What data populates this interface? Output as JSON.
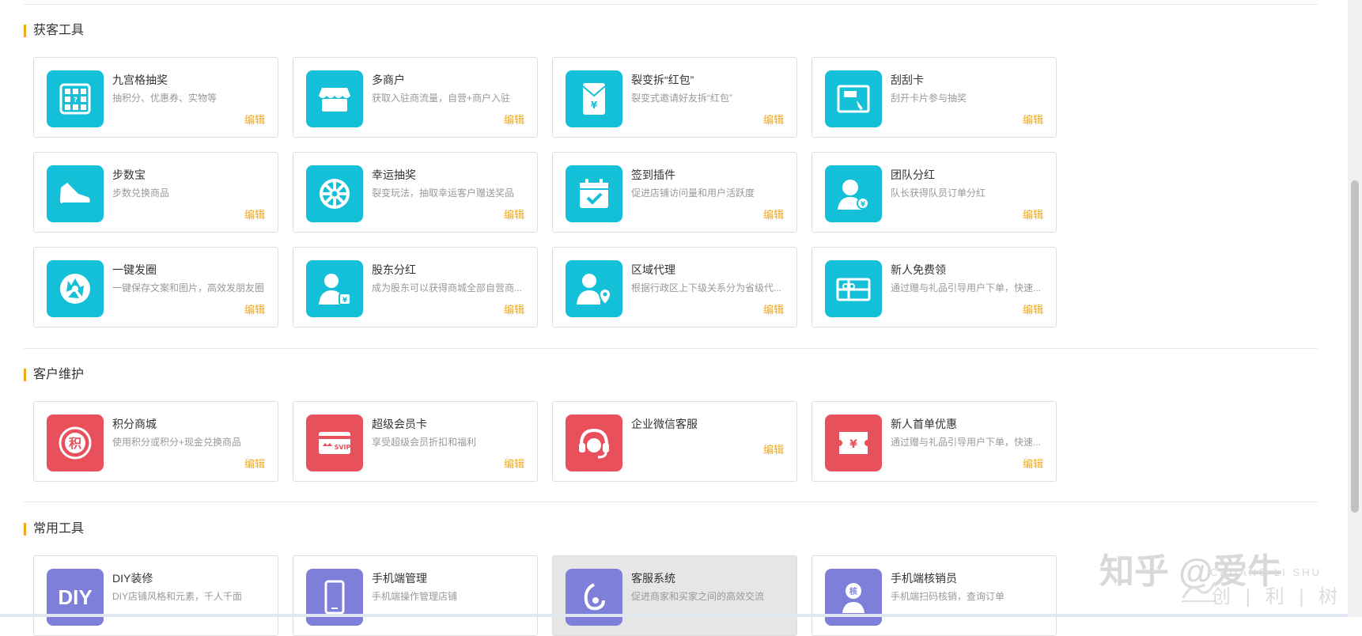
{
  "sections": [
    {
      "title": "获客工具",
      "cards": [
        {
          "title": "九宫格抽奖",
          "desc": "抽积分、优惠券、实物等",
          "edit": "编辑",
          "icon": "grid-lottery-icon",
          "color": "#14c0d8"
        },
        {
          "title": "多商户",
          "desc": "获取入驻商流量，自营+商户入驻",
          "edit": "编辑",
          "icon": "store-icon",
          "color": "#14c0d8"
        },
        {
          "title": "裂变拆“红包”",
          "desc": "裂变式邀请好友拆“红包”",
          "edit": "编辑",
          "icon": "red-envelope-icon",
          "color": "#14c0d8"
        },
        {
          "title": "刮刮卡",
          "desc": "刮开卡片参与抽奖",
          "edit": "编辑",
          "icon": "scratch-card-icon",
          "color": "#14c0d8"
        },
        {
          "title": "步数宝",
          "desc": "步数兑换商品",
          "edit": "编辑",
          "icon": "sneaker-icon",
          "color": "#14c0d8"
        },
        {
          "title": "幸运抽奖",
          "desc": "裂变玩法，抽取幸运客户赠送奖品",
          "edit": "编辑",
          "icon": "wheel-icon",
          "color": "#14c0d8"
        },
        {
          "title": "签到插件",
          "desc": "促进店铺访问量和用户活跃度",
          "edit": "编辑",
          "icon": "calendar-check-icon",
          "color": "#14c0d8"
        },
        {
          "title": "团队分红",
          "desc": "队长获得队员订单分红",
          "edit": "编辑",
          "icon": "team-dividend-icon",
          "color": "#14c0d8"
        },
        {
          "title": "一键发圈",
          "desc": "一键保存文案和图片，高效发朋友圈",
          "edit": "编辑",
          "icon": "aperture-icon",
          "color": "#14c0d8"
        },
        {
          "title": "股东分红",
          "desc": "成为股东可以获得商城全部自营商...",
          "edit": "编辑",
          "icon": "shareholder-icon",
          "color": "#14c0d8"
        },
        {
          "title": "区域代理",
          "desc": "根据行政区上下级关系分为省级代...",
          "edit": "编辑",
          "icon": "region-agent-icon",
          "color": "#14c0d8"
        },
        {
          "title": "新人免费领",
          "desc": "通过赠与礼品引导用户下单，快速...",
          "edit": "编辑",
          "icon": "gift-icon",
          "color": "#14c0d8"
        }
      ]
    },
    {
      "title": "客户维护",
      "cards": [
        {
          "title": "积分商城",
          "desc": "使用积分或积分+现金兑换商品",
          "edit": "编辑",
          "icon": "points-mall-icon",
          "color": "#e8505b"
        },
        {
          "title": "超级会员卡",
          "desc": "享受超级会员折扣和福利",
          "edit": "编辑",
          "icon": "svip-card-icon",
          "color": "#e8505b"
        },
        {
          "title": "企业微信客服",
          "desc": "",
          "edit": "编辑",
          "icon": "headset-icon",
          "color": "#e8505b"
        },
        {
          "title": "新人首单优惠",
          "desc": "通过赠与礼品引导用户下单，快速...",
          "edit": "编辑",
          "icon": "coupon-icon",
          "color": "#e8505b"
        }
      ]
    },
    {
      "title": "常用工具",
      "cards": [
        {
          "title": "DIY装修",
          "desc": "DIY店铺风格和元素，千人千面",
          "edit": "",
          "icon": "diy-icon",
          "color": "#7e7fd9"
        },
        {
          "title": "手机端管理",
          "desc": "手机端操作管理店铺",
          "edit": "",
          "icon": "phone-icon",
          "color": "#7e7fd9"
        },
        {
          "title": "客服系统",
          "desc": "促进商家和买家之间的高效交流",
          "edit": "",
          "icon": "customer-service-icon",
          "color": "#7e7fd9"
        },
        {
          "title": "手机端核销员",
          "desc": "手机端扫码核销，查询订单",
          "edit": "",
          "icon": "verify-scan-icon",
          "color": "#7e7fd9"
        }
      ]
    }
  ],
  "diy_icon_text": "DIY",
  "svip_text": "SVIP",
  "watermark": {
    "main": "知乎 @爱牛",
    "sub": "CHUANG LI SHU",
    "sub2": "创 | 利 | 树"
  }
}
